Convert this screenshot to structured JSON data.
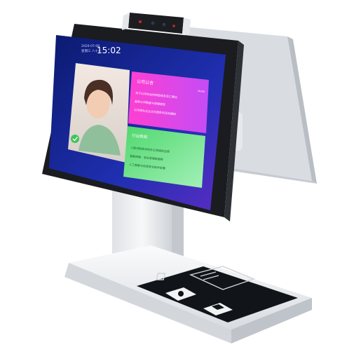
{
  "screen": {
    "date": "2020-07-08",
    "weekday": "星期三 八十一",
    "time": "15:02"
  },
  "announcements": {
    "title": "公司公告",
    "more": "MORE",
    "items": [
      "关于公司年会时间安排及员工建议",
      "最新公司制度与管理规定",
      "公司举办企业文化周系列活动通知"
    ]
  },
  "news": {
    "title": "行业新闻",
    "items": [
      "人脸识别技术在办公领域的应用",
      "智能终端 · 安全管理新趋势",
      "人工智能与信息安全技术发展"
    ]
  },
  "colors": {
    "screen_bg": "#1c2fa8",
    "announcement_panel": "#d83cf0",
    "news_panel": "#64e08a",
    "device_body": "#eef0f2",
    "scanner_glass": "#111418"
  }
}
